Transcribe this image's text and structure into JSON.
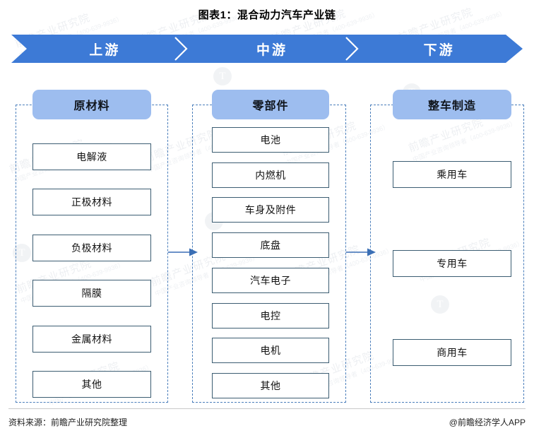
{
  "title": "图表1：混合动力汽车产业链",
  "banner": {
    "segments": [
      {
        "label": "上游"
      },
      {
        "label": "中游"
      },
      {
        "label": "下游"
      }
    ],
    "color": "#3d7ad6"
  },
  "colors": {
    "banner_blue": "#3d7ad6",
    "header_blue": "#9dbdef",
    "dashed_border": "#4a7ebb",
    "box_border": "#3c5d72",
    "arrow_blue": "#3b6fb5"
  },
  "columns": [
    {
      "key": "upstream",
      "header": "原材料",
      "items": [
        {
          "label": "电解液"
        },
        {
          "label": "正极材料"
        },
        {
          "label": "负极材料"
        },
        {
          "label": "隔膜"
        },
        {
          "label": "金属材料"
        },
        {
          "label": "其他"
        }
      ]
    },
    {
      "key": "midstream",
      "header": "零部件",
      "items": [
        {
          "label": "电池"
        },
        {
          "label": "内燃机"
        },
        {
          "label": "车身及附件"
        },
        {
          "label": "底盘"
        },
        {
          "label": "汽车电子"
        },
        {
          "label": "电控"
        },
        {
          "label": "电机"
        },
        {
          "label": "其他"
        }
      ]
    },
    {
      "key": "downstream",
      "header": "整车制造",
      "items": [
        {
          "label": "乘用车"
        },
        {
          "label": "专用车"
        },
        {
          "label": "商用车"
        }
      ]
    }
  ],
  "connectors": [
    {
      "name": "upstream-to-midstream"
    },
    {
      "name": "midstream-to-downstream"
    }
  ],
  "footer": {
    "source": "资料来源：前瞻产业研究院整理",
    "app": "@前瞻经济学人APP"
  },
  "watermark": {
    "text": "前瞻产业研究院",
    "sub": "中国产业咨询领导者（400-639-9936）",
    "logo": "T"
  }
}
